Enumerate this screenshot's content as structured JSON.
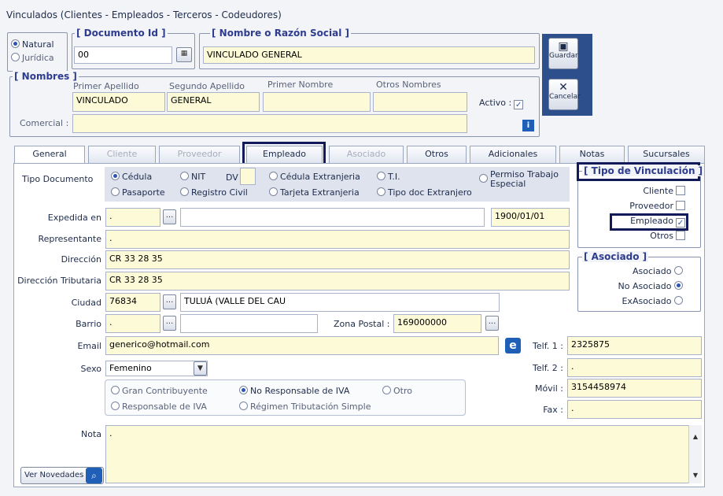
{
  "window": {
    "title": "Vinculados   (Clientes - Empleados - Terceros - Codeudores)"
  },
  "persona": {
    "natural": "Natural",
    "juridica": "Jurídica"
  },
  "documento": {
    "legend": "[ Documento Id ]",
    "value": "00"
  },
  "nombre": {
    "legend": "[ Nombre o Razón Social ]",
    "value": "VINCULADO GENERAL"
  },
  "nombres": {
    "legend": "[ Nombres ]",
    "primer_apellido_label": "Primer Apellido",
    "primer_apellido": "VINCULADO",
    "segundo_apellido_label": "Segundo Apellido",
    "segundo_apellido": "GENERAL",
    "primer_nombre_label": "Primer Nombre",
    "primer_nombre": "",
    "otros_nombres_label": "Otros Nombres",
    "otros_nombres": "",
    "activo_label": "Activo :",
    "comercial_label": "Comercial :",
    "comercial": ""
  },
  "actions": {
    "guardar": "Guardar",
    "cancelar": "Cancelar"
  },
  "tabs": [
    "General",
    "Cliente",
    "Proveedor",
    "Empleado",
    "Asociado",
    "Otros",
    "Adicionales",
    "Notas",
    "Sucursales"
  ],
  "tipo_doc": {
    "label": "Tipo Documento",
    "cedula": "Cédula",
    "nit": "NIT",
    "dv": "DV",
    "cedula_ext": "Cédula Extranjeria",
    "ti": "T.I.",
    "permiso": "Permiso Trabajo Especial",
    "pasaporte": "Pasaporte",
    "registro": "Registro Civil",
    "tarjeta": "Tarjeta Extranjeria",
    "tipo_ext": "Tipo doc Extranjero"
  },
  "form": {
    "expedida_label": "Expedida en",
    "expedida": ".",
    "fecha": "1900/01/01",
    "representante_label": "Representante",
    "representante": ".",
    "direccion_label": "Dirección",
    "direccion": "CR 33  28  35",
    "dir_trib_label": "Dirección Tributaria",
    "dir_trib": "CR 33 28 35",
    "ciudad_label": "Ciudad",
    "ciudad_code": "76834",
    "ciudad_name": "TULUÁ (VALLE DEL CAU",
    "barrio_label": "Barrio",
    "barrio": ".",
    "zona_label": "Zona Postal :",
    "zona": "169000000",
    "email_label": "Email",
    "email": "generico@hotmail.com",
    "sexo_label": "Sexo",
    "sexo": "Femenino",
    "telf1_label": "Telf. 1 :",
    "telf1": "2325875",
    "telf2_label": "Telf. 2 :",
    "telf2": ".",
    "movil_label": "Móvil :",
    "movil": "3154458974",
    "fax_label": "Fax :",
    "fax": ".",
    "nota_label": "Nota",
    "nota": ".",
    "ver_novedades": "Ver Novedades"
  },
  "iva": {
    "gran": "Gran Contribuyente",
    "no_resp": "No Responsable de IVA",
    "otro": "Otro",
    "resp": "Responsable de IVA",
    "regimen": "Régimen Tributación Simple"
  },
  "vinculacion": {
    "legend": "[ Tipo de Vinculación ]",
    "cliente": "Cliente",
    "proveedor": "Proveedor",
    "empleado": "Empleado",
    "otros": "Otros"
  },
  "asociado": {
    "legend": "[ Asociado ]",
    "asociado": "Asociado",
    "no_asociado": "No Asociado",
    "ex": "ExAsociado"
  }
}
